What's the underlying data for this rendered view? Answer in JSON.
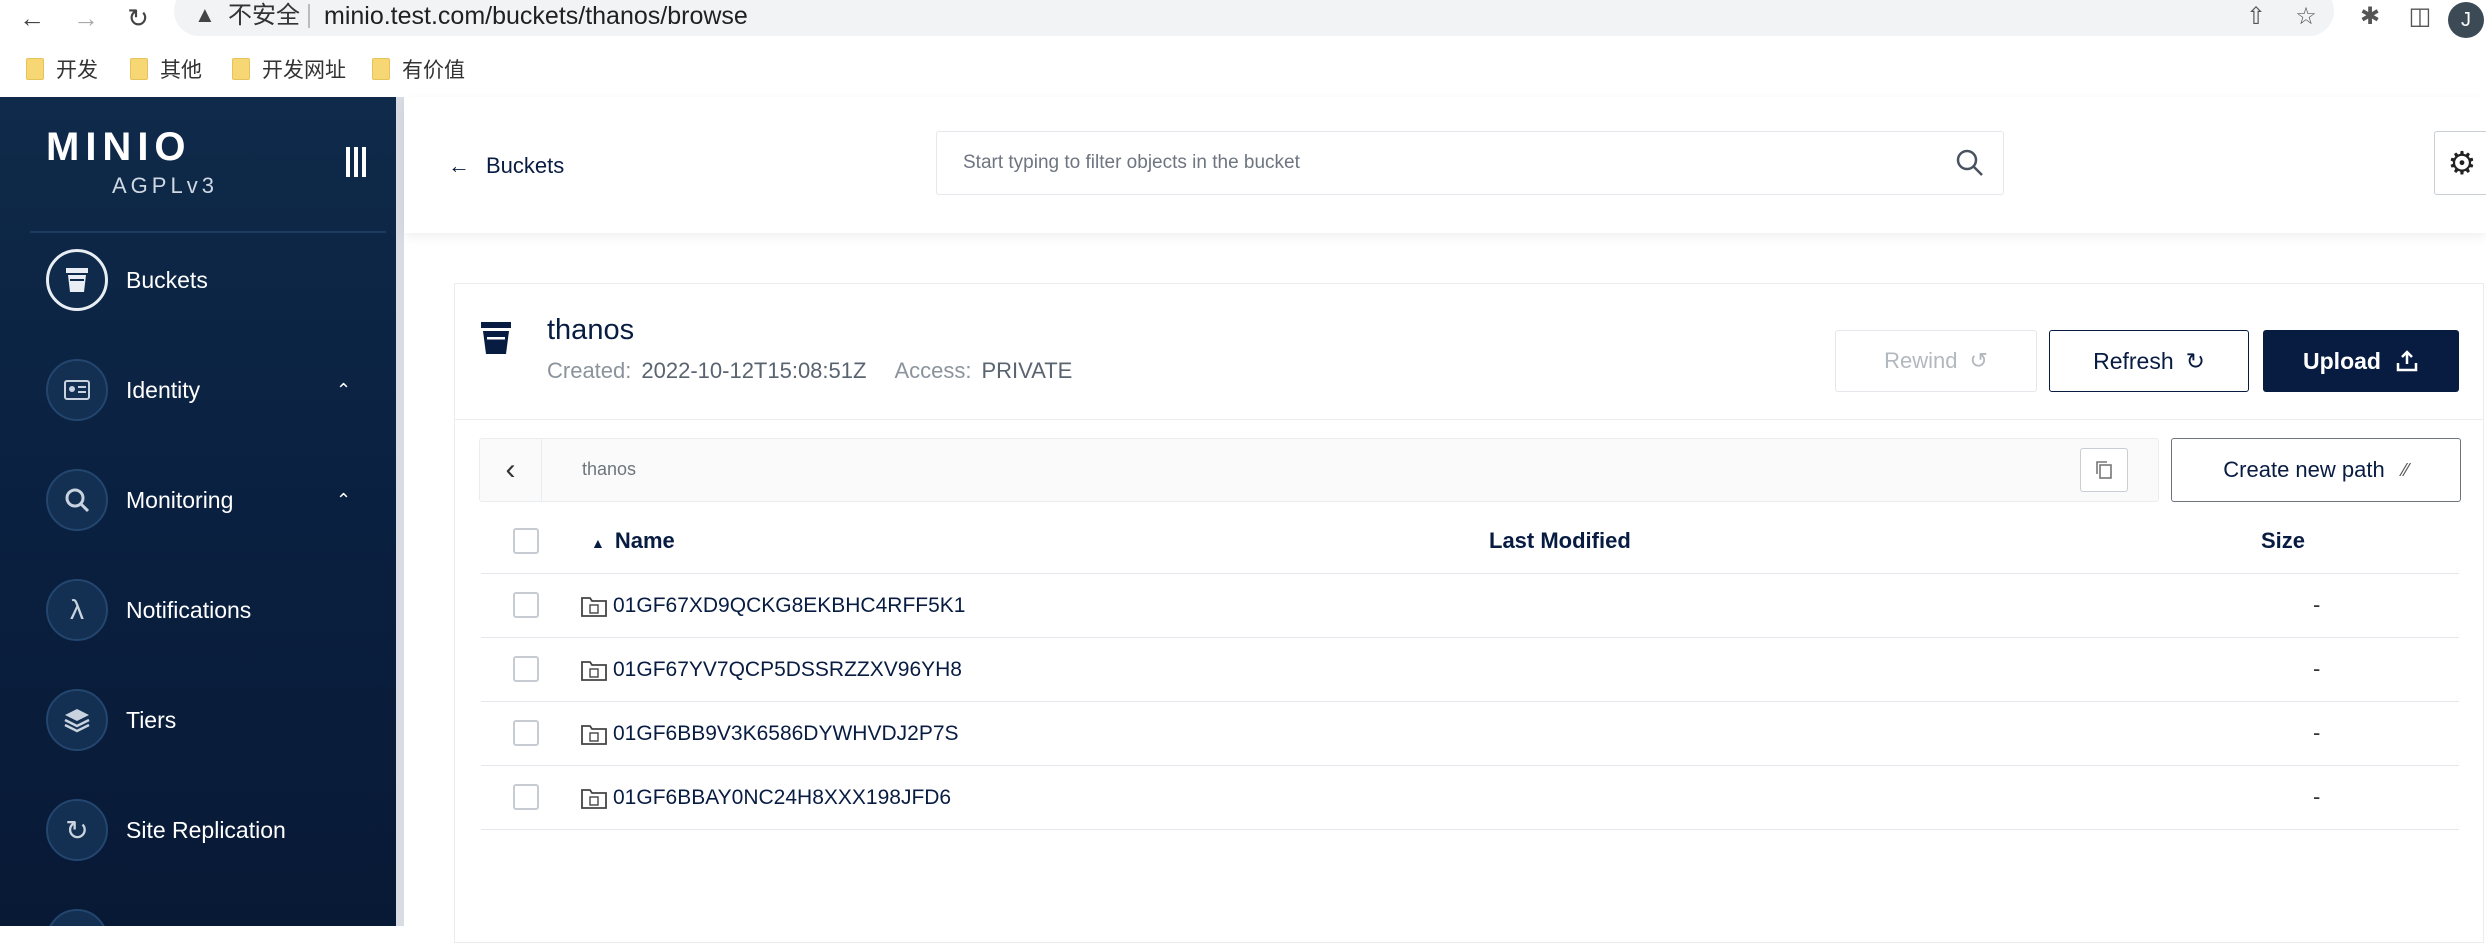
{
  "browser": {
    "insecure_label": "不安全",
    "url": "minio.test.com/buckets/thanos/browse",
    "avatar_initial": "J",
    "bookmarks": [
      "开发",
      "其他",
      "开发网址",
      "有价值"
    ]
  },
  "sidebar": {
    "logo": "MINIO",
    "license": "AGPLv3",
    "items": [
      {
        "label": "Buckets",
        "icon": "bucket-icon",
        "active": true
      },
      {
        "label": "Identity",
        "icon": "id-card-icon",
        "expandable": true
      },
      {
        "label": "Monitoring",
        "icon": "magnifier-icon",
        "expandable": true
      },
      {
        "label": "Notifications",
        "icon": "lambda-icon"
      },
      {
        "label": "Tiers",
        "icon": "layers-icon"
      },
      {
        "label": "Site Replication",
        "icon": "sync-icon"
      }
    ]
  },
  "header": {
    "back_label": "Buckets",
    "search_placeholder": "Start typing to filter objects in the bucket"
  },
  "bucket": {
    "name": "thanos",
    "created_label": "Created:",
    "created_value": "2022-10-12T15:08:51Z",
    "access_label": "Access:",
    "access_value": "PRIVATE"
  },
  "actions": {
    "rewind": "Rewind",
    "refresh": "Refresh",
    "upload": "Upload",
    "create_path": "Create new path"
  },
  "path": {
    "current": "thanos"
  },
  "table": {
    "columns": {
      "name": "Name",
      "modified": "Last Modified",
      "size": "Size"
    },
    "rows": [
      {
        "name": "01GF67XD9QCKG8EKBHC4RFF5K1",
        "modified": "",
        "size": "-"
      },
      {
        "name": "01GF67YV7QCP5DSSRZZXV96YH8",
        "modified": "",
        "size": "-"
      },
      {
        "name": "01GF6BB9V3K6586DYWHVDJ2P7S",
        "modified": "",
        "size": "-"
      },
      {
        "name": "01GF6BBAY0NC24H8XXX198JFD6",
        "modified": "",
        "size": "-"
      }
    ]
  },
  "colors": {
    "brand_navy": "#081c42",
    "sidebar_bg": "#0f2a4a"
  }
}
